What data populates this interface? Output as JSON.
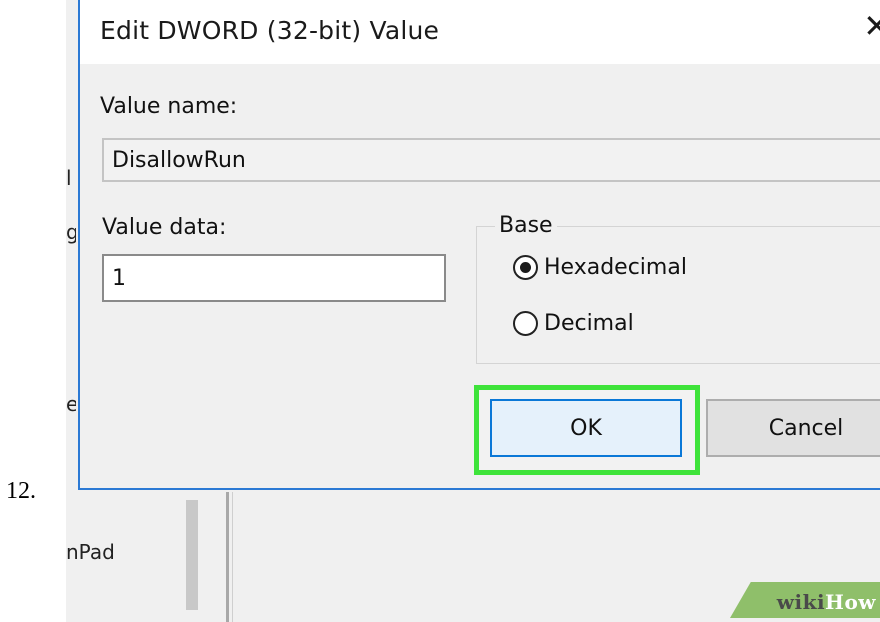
{
  "step_number": "12.",
  "background_window": {
    "fragment_1": "l",
    "fragment_2": "g",
    "fragment_3": "e",
    "pad_text": "nPad"
  },
  "dialog": {
    "title": "Edit DWORD (32-bit) Value",
    "close_glyph": "✕",
    "value_name_label": "Value name:",
    "value_name": "DisallowRun",
    "value_data_label": "Value data:",
    "value_data": "1",
    "base_label": "Base",
    "base_options": [
      {
        "label": "Hexadecimal",
        "selected": true
      },
      {
        "label": "Decimal",
        "selected": false
      }
    ],
    "ok_label": "OK",
    "cancel_label": "Cancel"
  },
  "highlight_color": "#3ee33a",
  "watermark": {
    "wiki": "wiki",
    "how": "How"
  }
}
